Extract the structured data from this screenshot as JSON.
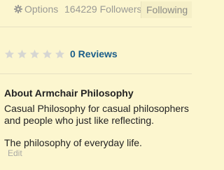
{
  "header": {
    "options_label": "Options",
    "followers_label": "164229 Followers",
    "following_label": "Following",
    "icons": {
      "options": "gear-icon"
    }
  },
  "rating": {
    "stars_filled": 0,
    "stars_total": 5,
    "reviews_label": "0 Reviews",
    "icons": {
      "star": "star-icon"
    }
  },
  "about": {
    "title": "About Armchair Philosophy",
    "line1": "Casual Philosophy for casual philosophers",
    "line2": "and people who just like reflecting.",
    "line3": "The philosophy of everyday life.",
    "edit_label": "Edit"
  },
  "colors": {
    "background": "#FCF6CF",
    "link_blue": "#1B5E8A",
    "muted_gray": "#9A9A95",
    "star_gray": "#D6D6D2"
  }
}
